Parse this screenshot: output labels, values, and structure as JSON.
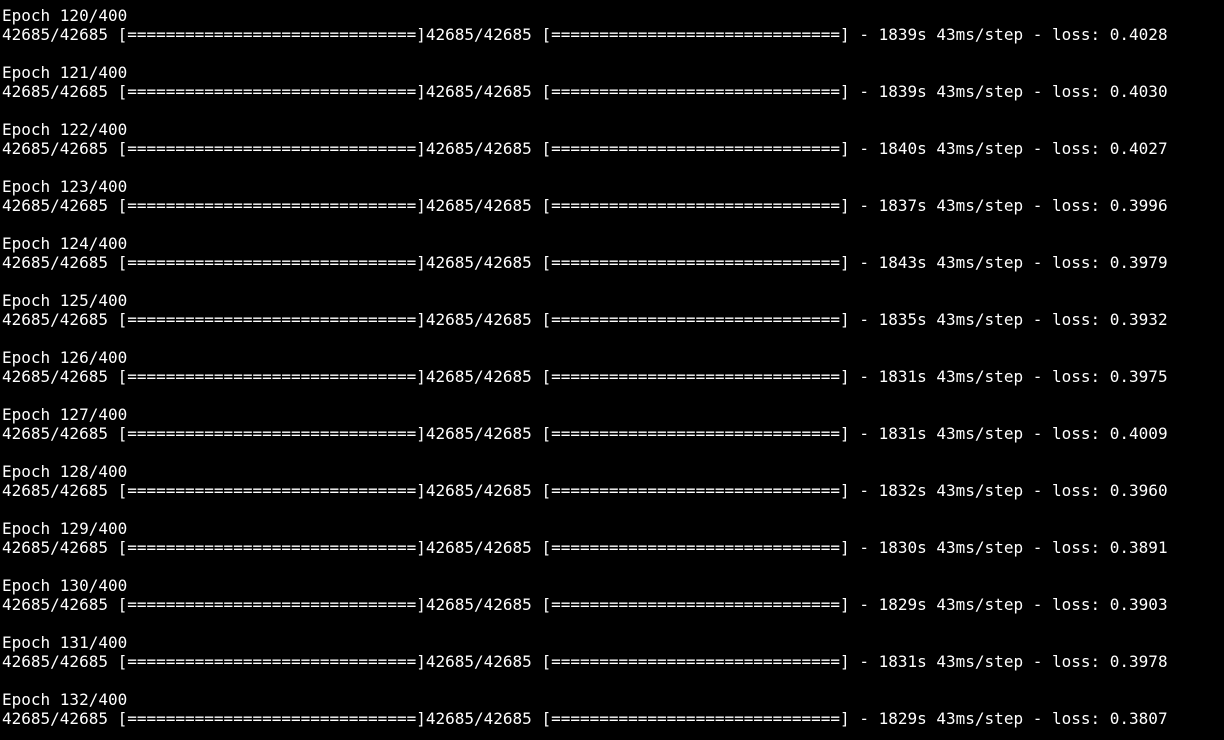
{
  "terminal": {
    "background": "#000000",
    "text_color": "#ffffff",
    "entries": [
      {
        "epoch": "Epoch 120/400",
        "progress": "42685/42685 [==============================]42685/42685 [==============================] - 1839s 43ms/step - loss: 0.4028"
      },
      {
        "epoch": "Epoch 121/400",
        "progress": "42685/42685 [==============================]42685/42685 [==============================] - 1839s 43ms/step - loss: 0.4030"
      },
      {
        "epoch": "Epoch 122/400",
        "progress": "42685/42685 [==============================]42685/42685 [==============================] - 1840s 43ms/step - loss: 0.4027"
      },
      {
        "epoch": "Epoch 123/400",
        "progress": "42685/42685 [==============================]42685/42685 [==============================] - 1837s 43ms/step - loss: 0.3996"
      },
      {
        "epoch": "Epoch 124/400",
        "progress": "42685/42685 [==============================]42685/42685 [==============================] - 1843s 43ms/step - loss: 0.3979"
      },
      {
        "epoch": "Epoch 125/400",
        "progress": "42685/42685 [==============================]42685/42685 [==============================] - 1835s 43ms/step - loss: 0.3932"
      },
      {
        "epoch": "Epoch 126/400",
        "progress": "42685/42685 [==============================]42685/42685 [==============================] - 1831s 43ms/step - loss: 0.3975"
      },
      {
        "epoch": "Epoch 127/400",
        "progress": "42685/42685 [==============================]42685/42685 [==============================] - 1831s 43ms/step - loss: 0.4009"
      },
      {
        "epoch": "Epoch 128/400",
        "progress": "42685/42685 [==============================]42685/42685 [==============================] - 1832s 43ms/step - loss: 0.3960"
      },
      {
        "epoch": "Epoch 129/400",
        "progress": "42685/42685 [==============================]42685/42685 [==============================] - 1830s 43ms/step - loss: 0.3891"
      },
      {
        "epoch": "Epoch 130/400",
        "progress": "42685/42685 [==============================]42685/42685 [==============================] - 1829s 43ms/step - loss: 0.3903"
      },
      {
        "epoch": "Epoch 131/400",
        "progress": "42685/42685 [==============================]42685/42685 [==============================] - 1831s 43ms/step - loss: 0.3978"
      },
      {
        "epoch": "Epoch 132/400",
        "progress": "42685/42685 [==============================]42685/42685 [==============================] - 1829s 43ms/step - loss: 0.3807"
      }
    ]
  }
}
